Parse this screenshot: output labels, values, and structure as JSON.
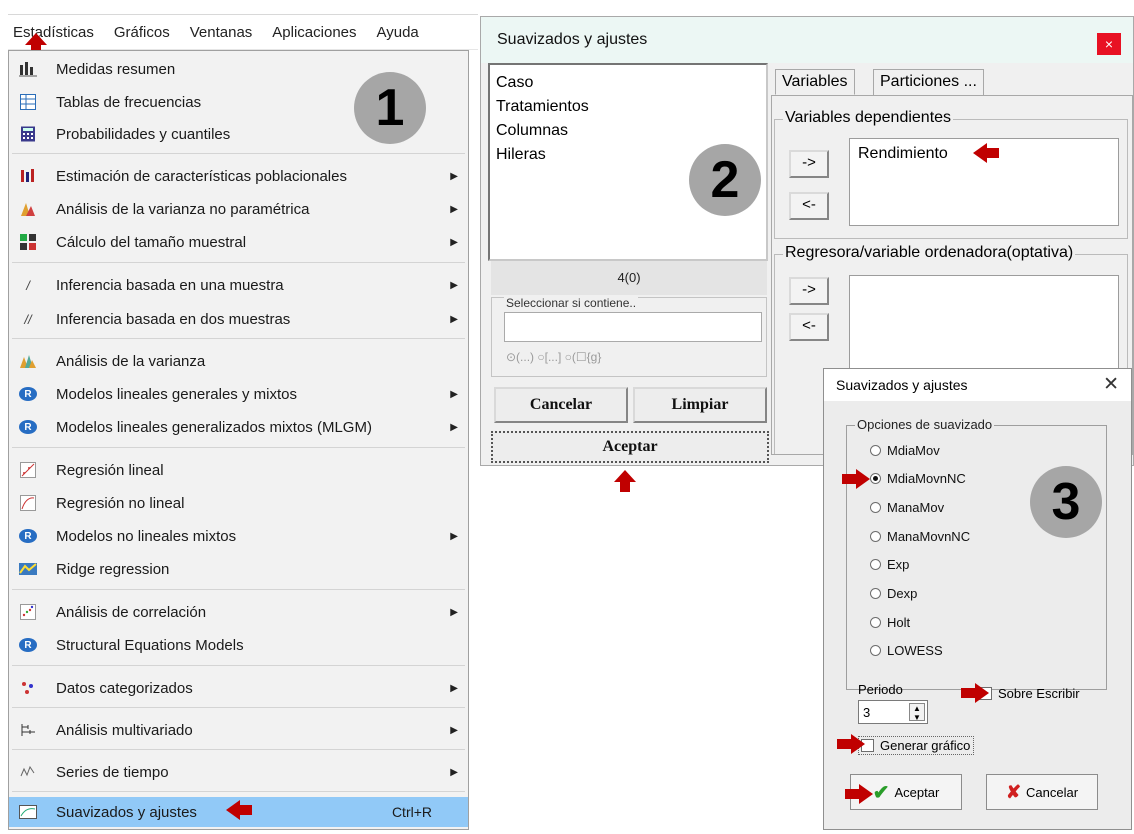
{
  "menubar": {
    "items": [
      "Estadísticas",
      "Gráficos",
      "Ventanas",
      "Aplicaciones",
      "Ayuda"
    ]
  },
  "badges": {
    "one": "1",
    "two": "2",
    "three": "3"
  },
  "menu": {
    "items": [
      {
        "label": "Medidas resumen",
        "icon": "summary-icon",
        "submenu": false
      },
      {
        "label": "Tablas de frecuencias",
        "icon": "frequency-table-icon",
        "submenu": false
      },
      {
        "label": "Probabilidades y cuantiles",
        "icon": "calculator-icon",
        "submenu": false
      },
      {
        "label": "Estimación de características poblacionales",
        "icon": "population-icon",
        "submenu": true
      },
      {
        "label": "Análisis de la varianza no paramétrica",
        "icon": "nonparametric-icon",
        "submenu": true
      },
      {
        "label": "Cálculo del tamaño muestral",
        "icon": "sample-size-icon",
        "submenu": true
      },
      {
        "label": "Inferencia basada en una muestra",
        "icon": "one-sample-icon",
        "submenu": true
      },
      {
        "label": "Inferencia basada en dos muestras",
        "icon": "two-samples-icon",
        "submenu": true
      },
      {
        "label": "Análisis de la varianza",
        "icon": "anova-icon",
        "submenu": false
      },
      {
        "label": "Modelos lineales generales y mixtos",
        "icon": "r-icon",
        "submenu": true
      },
      {
        "label": "Modelos lineales generalizados mixtos (MLGM)",
        "icon": "r-icon",
        "submenu": true
      },
      {
        "label": "Regresión lineal",
        "icon": "linear-regression-icon",
        "submenu": false
      },
      {
        "label": "Regresión no lineal",
        "icon": "nonlinear-regression-icon",
        "submenu": false
      },
      {
        "label": "Modelos no lineales mixtos",
        "icon": "r-icon",
        "submenu": true
      },
      {
        "label": "Ridge regression",
        "icon": "ridge-icon",
        "submenu": false
      },
      {
        "label": "Análisis de correlación",
        "icon": "correlation-icon",
        "submenu": true
      },
      {
        "label": "Structural Equations Models",
        "icon": "r-icon",
        "submenu": false
      },
      {
        "label": "Datos categorizados",
        "icon": "categorical-icon",
        "submenu": true
      },
      {
        "label": "Análisis multivariado",
        "icon": "multivariate-icon",
        "submenu": true
      },
      {
        "label": "Series de tiempo",
        "icon": "time-series-icon",
        "submenu": true
      },
      {
        "label": "Suavizados y ajustes",
        "icon": "smoothing-icon",
        "submenu": false,
        "shortcut": "Ctrl+R",
        "highlighted": true
      }
    ]
  },
  "dialog2": {
    "title": "Suavizados y ajustes",
    "close": "×",
    "variables": [
      "Caso",
      "Tratamientos",
      "Columnas",
      "Hileras"
    ],
    "count": "4(0)",
    "select_label": "Seleccionar si contiene..",
    "select_value": "",
    "select_options": "⊙(...)   ○[...]   ○(☐{g}",
    "cancel": "Cancelar",
    "clear": "Limpiar",
    "accept": "Aceptar",
    "tabs": [
      "Variables",
      "Particiones ..."
    ],
    "dependent_label": "Variables dependientes",
    "dependent_values": [
      "Rendimiento"
    ],
    "regressor_label": "Regresora/variable ordenadora(optativa)",
    "move_right": "->",
    "move_left": "<-"
  },
  "dialog3": {
    "title": "Suavizados y ajustes",
    "close": "✕",
    "group_label": "Opciones de suavizado",
    "options": [
      "MdiaMov",
      "MdiaMovnNC",
      "ManaMov",
      "ManaMovnNC",
      "Exp",
      "Dexp",
      "Holt",
      "LOWESS"
    ],
    "selected": "MdiaMovnNC",
    "period_label": "Periodo",
    "period_value": "3",
    "overwrite_label": "Sobre Escribir",
    "overwrite_checked": false,
    "chart_label": "Generar gráfico",
    "chart_checked": false,
    "accept": "Aceptar",
    "cancel": "Cancelar"
  },
  "colors": {
    "accent_red": "#c00000",
    "highlight": "#91c9f7",
    "badge": "#a6a6a6"
  }
}
